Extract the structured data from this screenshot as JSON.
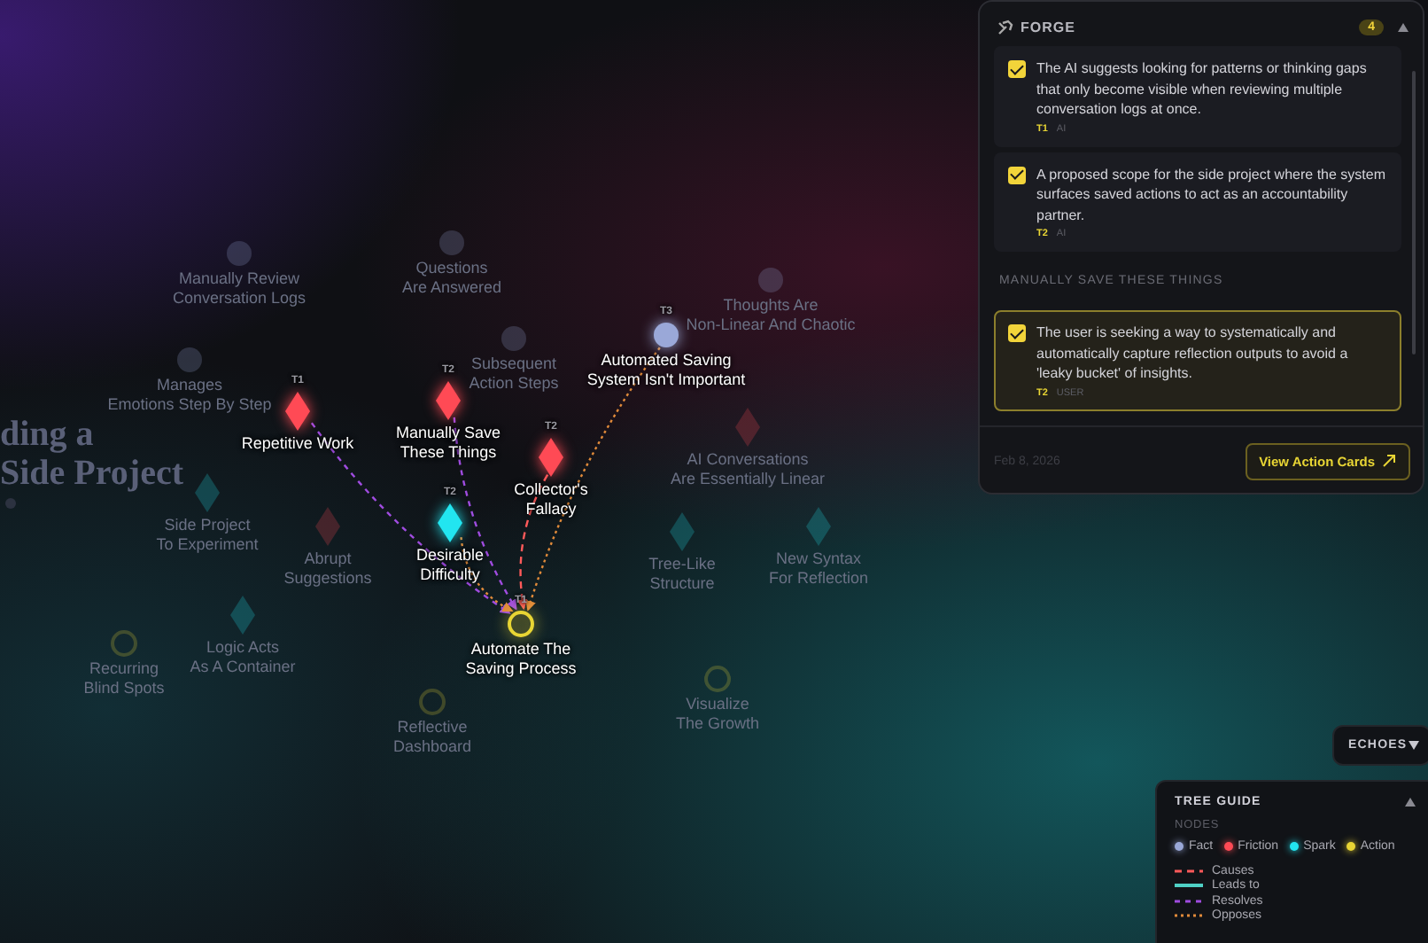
{
  "backdrop_title": [
    "ding a",
    "Side Project"
  ],
  "nodes": [
    {
      "label": "Manually Review\nConversation Logs",
      "kind": "fact",
      "dimmed": true
    },
    {
      "label": "Questions\nAre Answered",
      "kind": "fact",
      "dimmed": true
    },
    {
      "label": "Thoughts Are\nNon-Linear And Chaotic",
      "kind": "fact",
      "dimmed": true
    },
    {
      "label": "Manages\nEmotions Step By Step",
      "kind": "fact",
      "dimmed": true
    },
    {
      "label": "Subsequent\nAction Steps",
      "kind": "fact",
      "dimmed": true
    },
    {
      "label": "Automated Saving\nSystem Isn't Important",
      "kind": "fact",
      "dimmed": false,
      "turn": "T3",
      "edge": {
        "kind": "opposes"
      }
    },
    {
      "label": "Repetitive Work",
      "kind": "friction",
      "dimmed": false,
      "turn": "T1",
      "edge": {
        "kind": "resolves"
      }
    },
    {
      "label": "Manually Save\nThese Things",
      "kind": "friction",
      "dimmed": false,
      "turn": "T2",
      "edge": {
        "kind": "resolves"
      }
    },
    {
      "label": "Collector's\nFallacy",
      "kind": "friction",
      "dimmed": false,
      "turn": "T2",
      "edge": {
        "kind": "causes"
      }
    },
    {
      "label": "AI Conversations\nAre Essentially Linear",
      "kind": "friction",
      "dimmed": true
    },
    {
      "label": "Side Project\nTo Experiment",
      "kind": "spark",
      "dimmed": true
    },
    {
      "label": "Abrupt\nSuggestions",
      "kind": "friction",
      "dimmed": true
    },
    {
      "label": "Desirable\nDifficulty",
      "kind": "spark",
      "dimmed": false,
      "turn": "T2",
      "edge": {
        "kind": "opposes"
      }
    },
    {
      "label": "Tree-Like\nStructure",
      "kind": "spark",
      "dimmed": true
    },
    {
      "label": "New Syntax\nFor Reflection",
      "kind": "spark",
      "dimmed": true
    },
    {
      "label": "Recurring\nBlind Spots",
      "kind": "action",
      "dimmed": true
    },
    {
      "label": "Logic Acts\nAs A Container",
      "kind": "spark",
      "dimmed": true
    },
    {
      "label": "Automate The\nSaving Process",
      "kind": "action",
      "dimmed": false,
      "turn": "T1",
      "focus": true
    },
    {
      "label": "Reflective\nDashboard",
      "kind": "action",
      "dimmed": true
    },
    {
      "label": "Visualize\nThe Growth",
      "kind": "action",
      "dimmed": true
    }
  ],
  "forge": {
    "title": "FORGE",
    "count": "4",
    "expanded": true,
    "groups": [
      {
        "cards": [
          {
            "text": "The AI suggests looking for patterns or thinking gaps that only become visible when reviewing multiple conversation logs at once.",
            "turn": "T1",
            "source": "AI",
            "checked": true,
            "selected": false
          },
          {
            "text": "A proposed scope for the side project where the system surfaces saved actions to act as an accountability partner.",
            "turn": "T2",
            "source": "AI",
            "checked": true,
            "selected": false
          }
        ]
      },
      {
        "heading": "MANUALLY SAVE THESE THINGS",
        "cards": [
          {
            "text": "The user is seeking a way to systematically and automatically capture reflection outputs to avoid a 'leaky bucket' of insights.",
            "turn": "T2",
            "source": "USER",
            "checked": true,
            "selected": true
          }
        ]
      }
    ],
    "date": "Feb 8, 2026",
    "button": "View Action Cards"
  },
  "echoes": {
    "label": "ECHOES",
    "expanded": false
  },
  "tree_guide": {
    "title": "TREE GUIDE",
    "expanded": true,
    "nodes_heading": "NODES",
    "node_types": [
      {
        "label": "Fact",
        "color": "#9aa8d8"
      },
      {
        "label": "Friction",
        "color": "#ff4a55"
      },
      {
        "label": "Spark",
        "color": "#22e5f0"
      },
      {
        "label": "Action",
        "color": "#e8d534"
      }
    ],
    "edge_types": [
      {
        "label": "Causes",
        "kind": "causes"
      },
      {
        "label": "Leads to",
        "kind": "leads"
      },
      {
        "label": "Resolves",
        "kind": "resolves"
      },
      {
        "label": "Opposes",
        "kind": "opposes"
      }
    ]
  }
}
